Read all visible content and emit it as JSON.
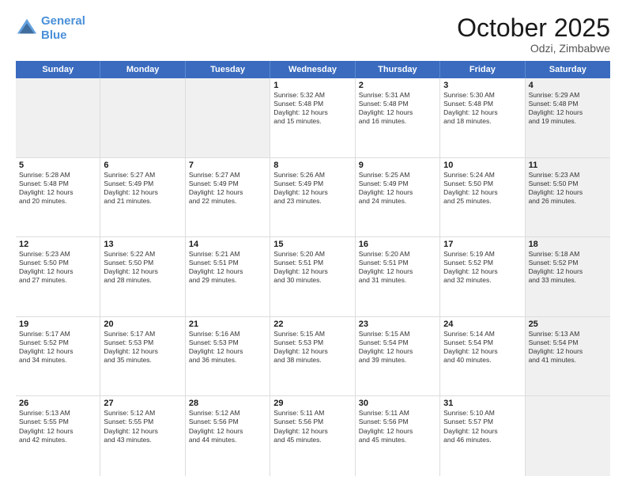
{
  "logo": {
    "line1": "General",
    "line2": "Blue"
  },
  "title": "October 2025",
  "location": "Odzi, Zimbabwe",
  "header_days": [
    "Sunday",
    "Monday",
    "Tuesday",
    "Wednesday",
    "Thursday",
    "Friday",
    "Saturday"
  ],
  "weeks": [
    [
      {
        "day": "",
        "text": "",
        "shaded": true
      },
      {
        "day": "",
        "text": "",
        "shaded": true
      },
      {
        "day": "",
        "text": "",
        "shaded": true
      },
      {
        "day": "1",
        "text": "Sunrise: 5:32 AM\nSunset: 5:48 PM\nDaylight: 12 hours\nand 15 minutes.",
        "shaded": false
      },
      {
        "day": "2",
        "text": "Sunrise: 5:31 AM\nSunset: 5:48 PM\nDaylight: 12 hours\nand 16 minutes.",
        "shaded": false
      },
      {
        "day": "3",
        "text": "Sunrise: 5:30 AM\nSunset: 5:48 PM\nDaylight: 12 hours\nand 18 minutes.",
        "shaded": false
      },
      {
        "day": "4",
        "text": "Sunrise: 5:29 AM\nSunset: 5:48 PM\nDaylight: 12 hours\nand 19 minutes.",
        "shaded": true
      }
    ],
    [
      {
        "day": "5",
        "text": "Sunrise: 5:28 AM\nSunset: 5:48 PM\nDaylight: 12 hours\nand 20 minutes.",
        "shaded": false
      },
      {
        "day": "6",
        "text": "Sunrise: 5:27 AM\nSunset: 5:49 PM\nDaylight: 12 hours\nand 21 minutes.",
        "shaded": false
      },
      {
        "day": "7",
        "text": "Sunrise: 5:27 AM\nSunset: 5:49 PM\nDaylight: 12 hours\nand 22 minutes.",
        "shaded": false
      },
      {
        "day": "8",
        "text": "Sunrise: 5:26 AM\nSunset: 5:49 PM\nDaylight: 12 hours\nand 23 minutes.",
        "shaded": false
      },
      {
        "day": "9",
        "text": "Sunrise: 5:25 AM\nSunset: 5:49 PM\nDaylight: 12 hours\nand 24 minutes.",
        "shaded": false
      },
      {
        "day": "10",
        "text": "Sunrise: 5:24 AM\nSunset: 5:50 PM\nDaylight: 12 hours\nand 25 minutes.",
        "shaded": false
      },
      {
        "day": "11",
        "text": "Sunrise: 5:23 AM\nSunset: 5:50 PM\nDaylight: 12 hours\nand 26 minutes.",
        "shaded": true
      }
    ],
    [
      {
        "day": "12",
        "text": "Sunrise: 5:23 AM\nSunset: 5:50 PM\nDaylight: 12 hours\nand 27 minutes.",
        "shaded": false
      },
      {
        "day": "13",
        "text": "Sunrise: 5:22 AM\nSunset: 5:50 PM\nDaylight: 12 hours\nand 28 minutes.",
        "shaded": false
      },
      {
        "day": "14",
        "text": "Sunrise: 5:21 AM\nSunset: 5:51 PM\nDaylight: 12 hours\nand 29 minutes.",
        "shaded": false
      },
      {
        "day": "15",
        "text": "Sunrise: 5:20 AM\nSunset: 5:51 PM\nDaylight: 12 hours\nand 30 minutes.",
        "shaded": false
      },
      {
        "day": "16",
        "text": "Sunrise: 5:20 AM\nSunset: 5:51 PM\nDaylight: 12 hours\nand 31 minutes.",
        "shaded": false
      },
      {
        "day": "17",
        "text": "Sunrise: 5:19 AM\nSunset: 5:52 PM\nDaylight: 12 hours\nand 32 minutes.",
        "shaded": false
      },
      {
        "day": "18",
        "text": "Sunrise: 5:18 AM\nSunset: 5:52 PM\nDaylight: 12 hours\nand 33 minutes.",
        "shaded": true
      }
    ],
    [
      {
        "day": "19",
        "text": "Sunrise: 5:17 AM\nSunset: 5:52 PM\nDaylight: 12 hours\nand 34 minutes.",
        "shaded": false
      },
      {
        "day": "20",
        "text": "Sunrise: 5:17 AM\nSunset: 5:53 PM\nDaylight: 12 hours\nand 35 minutes.",
        "shaded": false
      },
      {
        "day": "21",
        "text": "Sunrise: 5:16 AM\nSunset: 5:53 PM\nDaylight: 12 hours\nand 36 minutes.",
        "shaded": false
      },
      {
        "day": "22",
        "text": "Sunrise: 5:15 AM\nSunset: 5:53 PM\nDaylight: 12 hours\nand 38 minutes.",
        "shaded": false
      },
      {
        "day": "23",
        "text": "Sunrise: 5:15 AM\nSunset: 5:54 PM\nDaylight: 12 hours\nand 39 minutes.",
        "shaded": false
      },
      {
        "day": "24",
        "text": "Sunrise: 5:14 AM\nSunset: 5:54 PM\nDaylight: 12 hours\nand 40 minutes.",
        "shaded": false
      },
      {
        "day": "25",
        "text": "Sunrise: 5:13 AM\nSunset: 5:54 PM\nDaylight: 12 hours\nand 41 minutes.",
        "shaded": true
      }
    ],
    [
      {
        "day": "26",
        "text": "Sunrise: 5:13 AM\nSunset: 5:55 PM\nDaylight: 12 hours\nand 42 minutes.",
        "shaded": false
      },
      {
        "day": "27",
        "text": "Sunrise: 5:12 AM\nSunset: 5:55 PM\nDaylight: 12 hours\nand 43 minutes.",
        "shaded": false
      },
      {
        "day": "28",
        "text": "Sunrise: 5:12 AM\nSunset: 5:56 PM\nDaylight: 12 hours\nand 44 minutes.",
        "shaded": false
      },
      {
        "day": "29",
        "text": "Sunrise: 5:11 AM\nSunset: 5:56 PM\nDaylight: 12 hours\nand 45 minutes.",
        "shaded": false
      },
      {
        "day": "30",
        "text": "Sunrise: 5:11 AM\nSunset: 5:56 PM\nDaylight: 12 hours\nand 45 minutes.",
        "shaded": false
      },
      {
        "day": "31",
        "text": "Sunrise: 5:10 AM\nSunset: 5:57 PM\nDaylight: 12 hours\nand 46 minutes.",
        "shaded": false
      },
      {
        "day": "",
        "text": "",
        "shaded": true
      }
    ]
  ]
}
